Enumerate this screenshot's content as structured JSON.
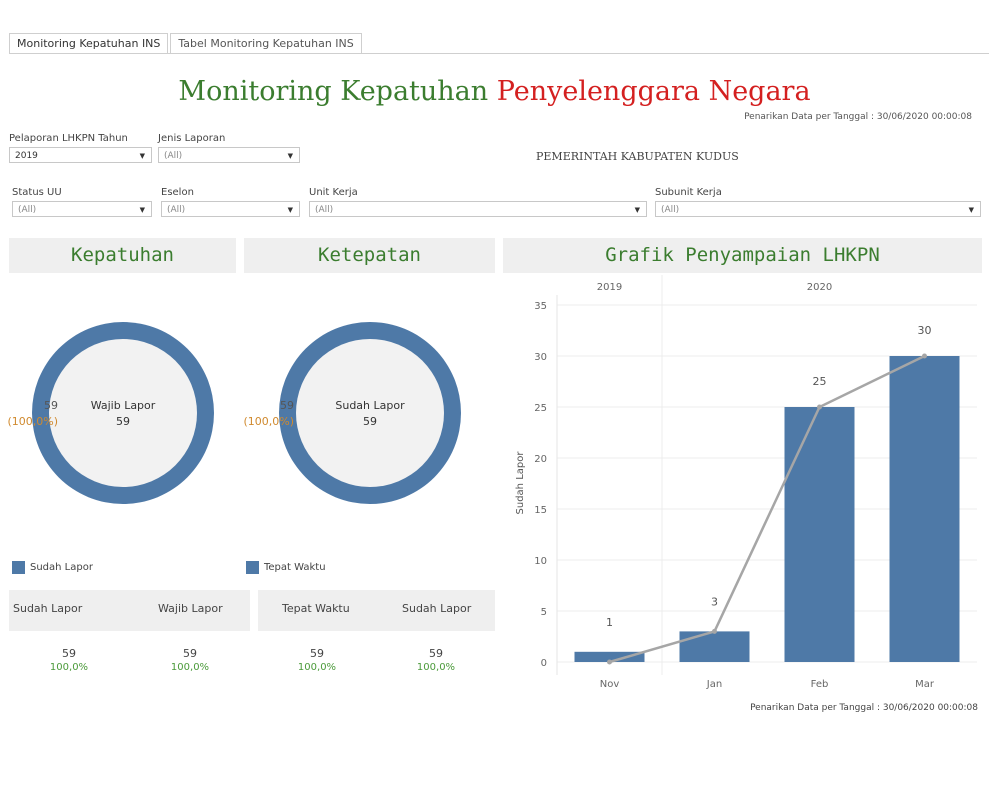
{
  "tabs": [
    "Monitoring Kepatuhan INS",
    "Tabel Monitoring Kepatuhan INS"
  ],
  "title": {
    "part1": "Monitoring Kepatuhan",
    "part2": "Penyelenggara Negara"
  },
  "date_text": "Penarikan Data per Tanggal : 30/06/2020 00:00:08",
  "organization": "PEMERINTAH KABUPATEN KUDUS",
  "filters": {
    "tahun": {
      "label": "Pelaporan LHKPN Tahun",
      "value": "2019"
    },
    "jenis": {
      "label": "Jenis Laporan",
      "value": "(All)"
    },
    "status": {
      "label": "Status UU",
      "value": "(All)"
    },
    "eselon": {
      "label": "Eselon",
      "value": "(All)"
    },
    "unit": {
      "label": "Unit Kerja",
      "value": "(All)"
    },
    "subunit": {
      "label": "Subunit Kerja",
      "value": "(All)"
    }
  },
  "sections": {
    "kepatuhan": "Kepatuhan",
    "ketepatan": "Ketepatan",
    "grafik": "Grafik Penyampaian LHKPN"
  },
  "kepatuhan": {
    "center_label": "Wajib Lapor",
    "center_value": "59",
    "side_value": "59",
    "side_pct": "(100,0%)",
    "legend": "Sudah Lapor",
    "col1": "Sudah Lapor",
    "col2": "Wajib Lapor",
    "val1": "59",
    "pct1": "100,0%",
    "val2": "59",
    "pct2": "100,0%"
  },
  "ketepatan": {
    "center_label": "Sudah Lapor",
    "center_value": "59",
    "side_value": "59",
    "side_pct": "(100,0%)",
    "legend": "Tepat Waktu",
    "col1": "Tepat Waktu",
    "col2": "Sudah Lapor",
    "val1": "59",
    "pct1": "100,0%",
    "val2": "59",
    "pct2": "100,0%"
  },
  "colors": {
    "bar": "#4e79a7",
    "line": "#a6a6a6",
    "title_green": "#3b7d2f",
    "title_red": "#d42020"
  },
  "chart_data": {
    "type": "bar",
    "year_headers": [
      "2019",
      "2020"
    ],
    "categories": [
      "Nov",
      "Jan",
      "Feb",
      "Mar"
    ],
    "values": [
      1,
      3,
      25,
      30
    ],
    "data_labels": [
      "1",
      "3",
      "25",
      "30"
    ],
    "line_values": [
      0,
      3,
      25,
      30
    ],
    "ylabel": "Sudah Lapor",
    "ylim": [
      0,
      35
    ],
    "yticks": [
      0,
      5,
      10,
      15,
      20,
      25,
      30,
      35
    ],
    "grid": true
  }
}
